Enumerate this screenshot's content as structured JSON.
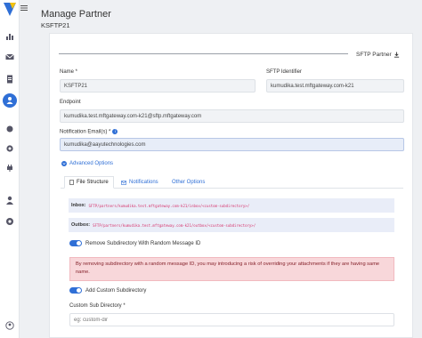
{
  "header": {
    "title": "Manage Partner",
    "subtitle": "KSFTP21"
  },
  "card": {
    "sftp_partner_label": "SFTP Partner"
  },
  "form": {
    "name_label": "Name *",
    "name_value": "KSFTP21",
    "sftp_identifier_label": "SFTP Identifier",
    "sftp_identifier_value": "kumudika.test.mftgateway.com-k21",
    "endpoint_label": "Endpoint",
    "endpoint_value": "kumudika.test.mftgateway.com-k21@sftp.mftgateway.com",
    "notification_label": "Notification Email(s) *",
    "notification_value": "kumudika@aayutechnologies.com"
  },
  "advanced": {
    "label": "Advanced Options"
  },
  "tabs": [
    {
      "label": "File Structure"
    },
    {
      "label": "Notifications"
    },
    {
      "label": "Other Options"
    }
  ],
  "file_structure": {
    "inbox_label": "Inbox:",
    "inbox_path": "SFTP/partners/kumudika.test.mftgateway.com-k21/inbox/<custom-subdirectory>/",
    "outbox_label": "Outbox:",
    "outbox_path": "SFTP/partners/kumudika.test.mftgateway.com-k21/outbox/<custom-subdirectory>/",
    "remove_subdir_label": "Remove Subdirectory With Random Message ID",
    "warning_text": "By removing subdirectory with a random message ID, you may introducing a risk of overriding your attachments if they are having same name.",
    "add_custom_label": "Add Custom Subdirectory",
    "custom_subdir_label": "Custom Sub Directory *",
    "custom_subdir_placeholder": "eg: custom-dir"
  },
  "colors": {
    "accent": "#2f6fd6",
    "warning_bg": "#f8d7da",
    "path_text": "#d6336c"
  }
}
